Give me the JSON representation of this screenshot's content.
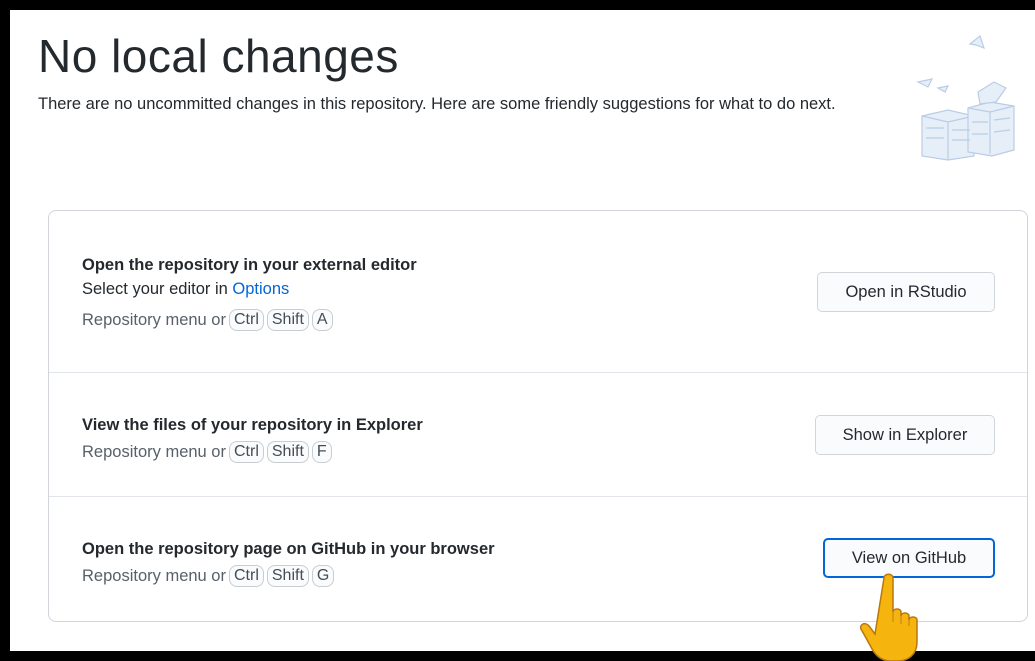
{
  "header": {
    "title": "No local changes",
    "subtitle": "There are no uncommitted changes in this repository. Here are some friendly suggestions for what to do next."
  },
  "suggestions": [
    {
      "title": "Open the repository in your external editor",
      "description_prefix": "Select your editor in ",
      "description_link": "Options",
      "shortcut_prefix": "Repository menu or",
      "keys": [
        "Ctrl",
        "Shift",
        "A"
      ],
      "button_label": "Open in RStudio"
    },
    {
      "title": "View the files of your repository in Explorer",
      "shortcut_prefix": "Repository menu or",
      "keys": [
        "Ctrl",
        "Shift",
        "F"
      ],
      "button_label": "Show in Explorer"
    },
    {
      "title": "Open the repository page on GitHub in your browser",
      "shortcut_prefix": "Repository menu or",
      "keys": [
        "Ctrl",
        "Shift",
        "G"
      ],
      "button_label": "View on GitHub",
      "focused": true
    }
  ],
  "colors": {
    "link": "#0366d6",
    "focus_ring": "#0366d6",
    "text": "#24292e",
    "muted": "#586069",
    "border": "#d1d5da",
    "cursor_hand": "#f6b40e"
  },
  "icons": {
    "illustration": "paper-stacks-illustration",
    "cursor": "pointing-hand-cursor-icon"
  }
}
